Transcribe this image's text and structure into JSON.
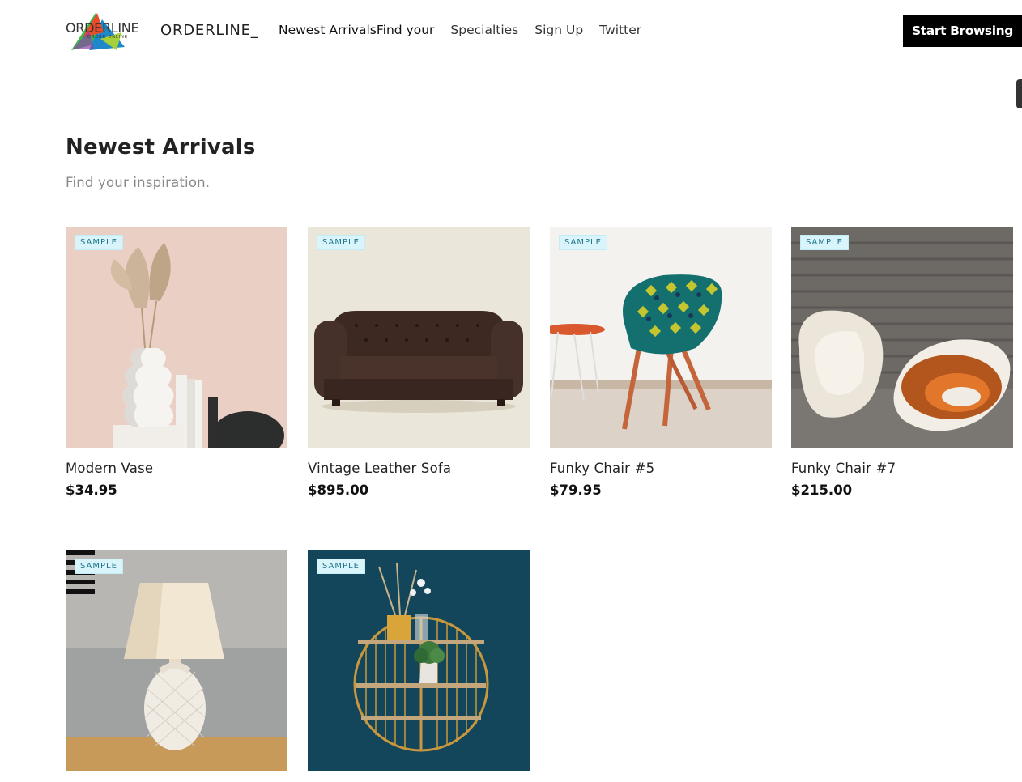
{
  "header": {
    "logo_text": "ORDERLINE",
    "logo_subtext": "ORDER ONLINE",
    "brand": "ORDERLINE_",
    "nav": [
      "Newest ArrivalsFind your",
      "Specialties",
      "Sign Up",
      "Twitter"
    ],
    "cta": "Start Browsing"
  },
  "section": {
    "title": "Newest Arrivals",
    "subtitle": "Find your inspiration."
  },
  "products": [
    {
      "badge": "SAMPLE",
      "name": "Modern Vase",
      "price": "$34.95"
    },
    {
      "badge": "SAMPLE",
      "name": "Vintage Leather Sofa",
      "price": "$895.00"
    },
    {
      "badge": "SAMPLE",
      "name": "Funky Chair #5",
      "price": "$79.95"
    },
    {
      "badge": "SAMPLE",
      "name": "Funky Chair #7",
      "price": "$215.00"
    },
    {
      "badge": "SAMPLE",
      "name": "",
      "price": ""
    },
    {
      "badge": "SAMPLE",
      "name": "",
      "price": ""
    }
  ],
  "colors": {
    "cta_background": "#000000",
    "badge_background": "#d9f4fb",
    "badge_text": "#1e7589",
    "subtitle": "#8a8a8a"
  }
}
